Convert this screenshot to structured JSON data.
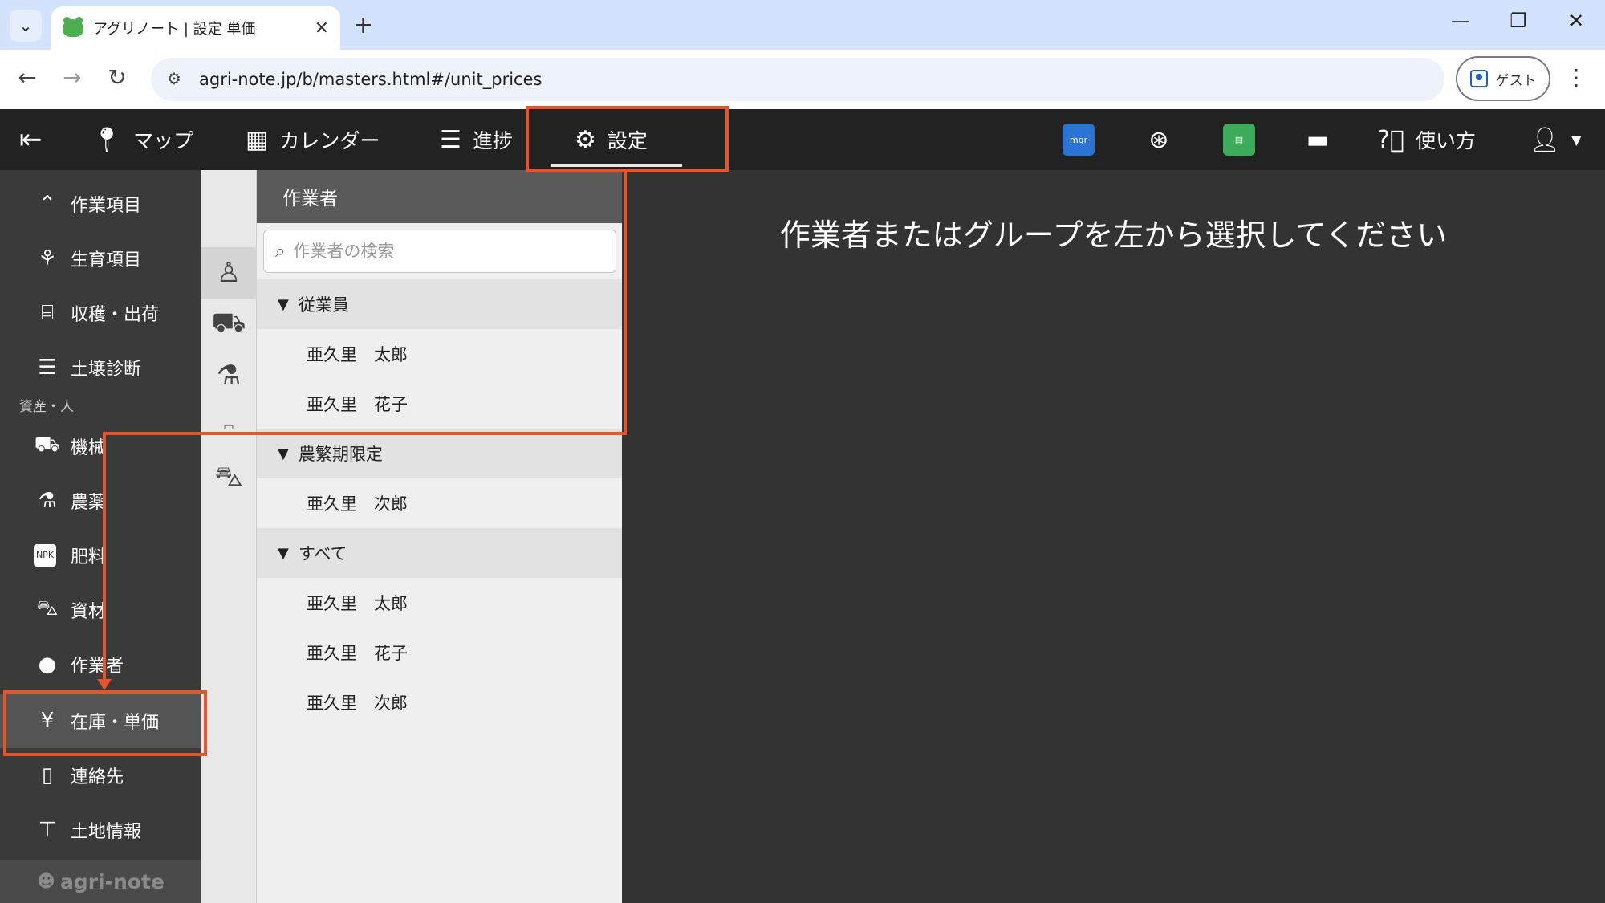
{
  "browser": {
    "tab_title": "アグリノート | 設定 単価",
    "url": "agri-note.jp/b/masters.html#/unit_prices",
    "guest_label": "ゲスト"
  },
  "header": {
    "nav": [
      {
        "label": "マップ",
        "icon": "map-pin-icon"
      },
      {
        "label": "カレンダー",
        "icon": "calendar-icon"
      },
      {
        "label": "進捗",
        "icon": "list-icon"
      },
      {
        "label": "設定",
        "icon": "gear-icon"
      }
    ],
    "help_label": "使い方",
    "app_icons": [
      "mgr-app-icon",
      "asterisk-app-icon",
      "green-app-icon",
      "chat-icon"
    ],
    "mgr_text": "mgr"
  },
  "sidebar": {
    "items_top": [
      {
        "label": "作業項目",
        "icon": "work-item-icon"
      },
      {
        "label": "生育項目",
        "icon": "growth-icon"
      },
      {
        "label": "収穫・出荷",
        "icon": "basket-icon"
      },
      {
        "label": "土壌診断",
        "icon": "sliders-icon"
      }
    ],
    "section_label": "資産・人",
    "items_bottom": [
      {
        "label": "機械",
        "icon": "tractor-icon"
      },
      {
        "label": "農薬",
        "icon": "flask-icon"
      },
      {
        "label": "肥料",
        "icon": "npk-icon",
        "icon_text": "NPK"
      },
      {
        "label": "資材",
        "icon": "wheelbarrow-icon"
      },
      {
        "label": "作業者",
        "icon": "person-icon"
      },
      {
        "label": "在庫・単価",
        "icon": "money-bag-icon",
        "active": true
      },
      {
        "label": "連絡先",
        "icon": "phone-icon"
      },
      {
        "label": "土地情報",
        "icon": "signpost-icon"
      }
    ],
    "footer_brand": "agri-note"
  },
  "list_panel": {
    "title": "作業者",
    "search_placeholder": "作業者の検索",
    "groups": [
      {
        "name": "従業員",
        "members": [
          "亜久里　太郎",
          "亜久里　花子"
        ]
      },
      {
        "name": "農繁期限定",
        "members": [
          "亜久里　次郎"
        ]
      },
      {
        "name": "すべて",
        "members": [
          "亜久里　太郎",
          "亜久里　花子",
          "亜久里　次郎"
        ]
      }
    ]
  },
  "main": {
    "message": "作業者またはグループを左から選択してください"
  },
  "colors": {
    "annotation": "#e8542a",
    "header_bg": "#222222",
    "sidebar_bg": "#3a3a3a"
  }
}
